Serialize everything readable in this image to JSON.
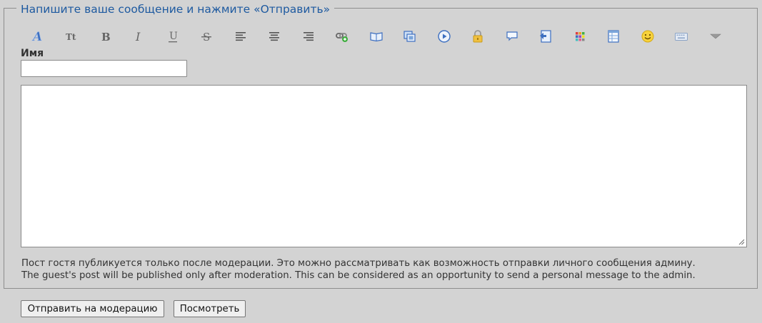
{
  "form": {
    "legend": "Напишите ваше сообщение и нажмите «Отправить»",
    "name_label": "Имя",
    "name_value": "",
    "message_value": "",
    "note_line1": "Пост гостя публикуется только после модерации. Это можно рассматривать как возможность отправки личного сообщения админу.",
    "note_line2": "The guest's post will be published only after moderation. This can be considered as an opportunity to send a personal message to the admin.",
    "submit_label": "Отправить на модерацию",
    "preview_label": "Посмотреть"
  },
  "toolbar": {
    "icons": [
      "font-face-icon",
      "font-size-icon",
      "bold-icon",
      "italic-icon",
      "underline-icon",
      "strikethrough-icon",
      "align-left-icon",
      "align-center-icon",
      "align-right-icon",
      "link-icon",
      "book-icon",
      "image-icon",
      "video-icon",
      "lock-icon",
      "speech-bubble-icon",
      "quote-icon",
      "color-palette-icon",
      "table-icon",
      "smiley-icon",
      "keyboard-icon",
      "more-dropdown-icon"
    ],
    "labels": {
      "font_size": "Tt",
      "bold": "B",
      "italic": "I",
      "underline": "U",
      "strike": "S"
    }
  },
  "colors": {
    "accent": "#1e5aa0",
    "background": "#d3d3d3"
  }
}
